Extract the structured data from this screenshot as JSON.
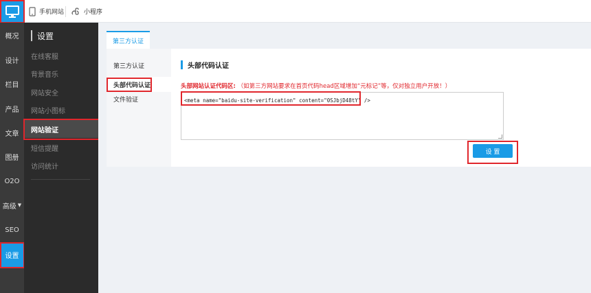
{
  "topbar": {
    "logo_icon": "desktop-icon",
    "mobile_tab": "手机网站",
    "miniprogram_tab": "小程序"
  },
  "rail": {
    "items": [
      {
        "label": "概况"
      },
      {
        "label": "设计"
      },
      {
        "label": "栏目"
      },
      {
        "label": "产品"
      },
      {
        "label": "文章"
      },
      {
        "label": "图册"
      },
      {
        "label": "O2O"
      },
      {
        "label": "高级"
      },
      {
        "label": "SEO"
      },
      {
        "label": "设置"
      }
    ],
    "active_index": 9
  },
  "sidebar": {
    "title": "设置",
    "items": [
      {
        "label": "在线客服"
      },
      {
        "label": "背景音乐"
      },
      {
        "label": "网站安全"
      },
      {
        "label": "网站小图标"
      },
      {
        "label": "网站验证"
      },
      {
        "label": "短信提醒"
      },
      {
        "label": "访问统计"
      }
    ],
    "active_index": 4
  },
  "main": {
    "tab_label": "第三方认证",
    "subnav": [
      {
        "label": "第三方认证"
      },
      {
        "label": "头部代码认证"
      },
      {
        "label": "文件验证"
      }
    ],
    "section_title": "头部代码认证",
    "note_label": "头部网站认证代码区:",
    "note_text": "（如第三方网站要求在首页代码head区域增加“元标记”等，仅对独立用户开放！）",
    "textarea_value": "<meta name=\"baidu-site-verification\" content=\"0SJbjD48tY\" />",
    "submit_label": "设 置"
  },
  "colors": {
    "accent": "#1a9be6",
    "highlight": "#e0262c",
    "rail_bg": "#3a3a3a",
    "sidebar_bg": "#2b2b2b"
  }
}
